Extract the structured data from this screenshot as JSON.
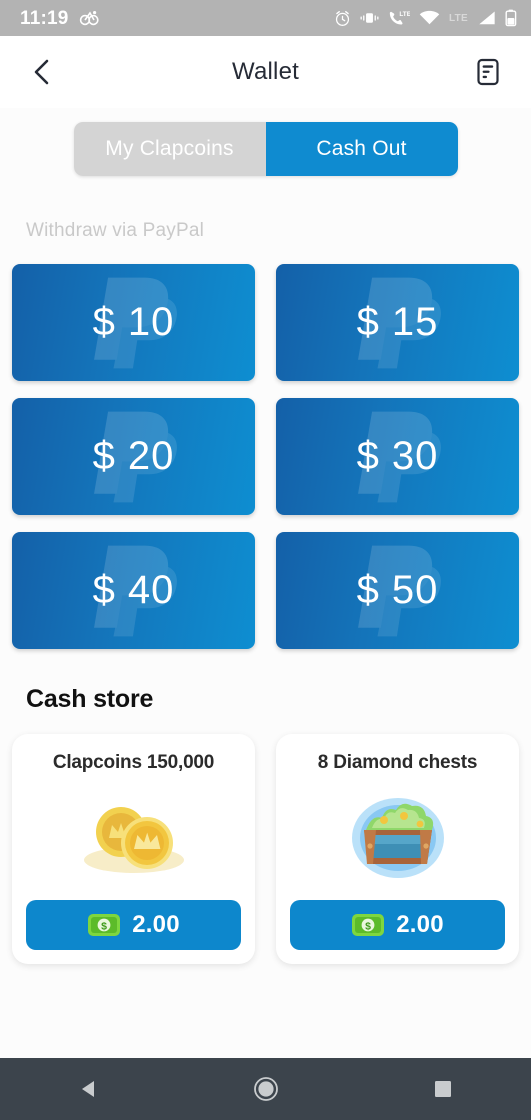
{
  "statusbar": {
    "time": "11:19",
    "left_icons": [
      "notification-icon"
    ],
    "right_icons": [
      "alarm-icon",
      "vibrate-icon",
      "volte-call-icon",
      "wifi-icon"
    ],
    "lte_label": "LTE",
    "signal_icon": "signal-bars-icon",
    "battery_icon": "battery-icon"
  },
  "header": {
    "back_icon": "back-chevron-icon",
    "title": "Wallet",
    "action_icon": "document-list-icon"
  },
  "tabs": [
    {
      "label": "My Clapcoins",
      "active": false
    },
    {
      "label": "Cash Out",
      "active": true
    }
  ],
  "withdraw": {
    "subtitle": "Withdraw via PayPal",
    "amounts": [
      {
        "label": "$ 10"
      },
      {
        "label": "$ 15"
      },
      {
        "label": "$ 20"
      },
      {
        "label": "$ 30"
      },
      {
        "label": "$ 40"
      },
      {
        "label": "$ 50"
      }
    ]
  },
  "cash_store": {
    "title": "Cash store",
    "items": [
      {
        "name": "Clapcoins 150,000",
        "art": "gold-coins-icon",
        "price": "2.00",
        "price_icon": "money-bill-icon"
      },
      {
        "name": "8 Diamond chests",
        "art": "treasure-chest-icon",
        "price": "2.00",
        "price_icon": "money-bill-icon"
      }
    ]
  },
  "navbar": {
    "back": "nav-back-icon",
    "home": "nav-home-icon",
    "recents": "nav-recents-icon"
  },
  "colors": {
    "accent_blue": "#0f8bd0",
    "card_blue_dark": "#1460a8",
    "card_blue_light": "#0e8ed1",
    "tab_inactive": "#d4d4d4",
    "price_blue": "#0d87cc",
    "statusbar_gray": "#b3b3b3",
    "navbar_dark": "#3c444c"
  }
}
